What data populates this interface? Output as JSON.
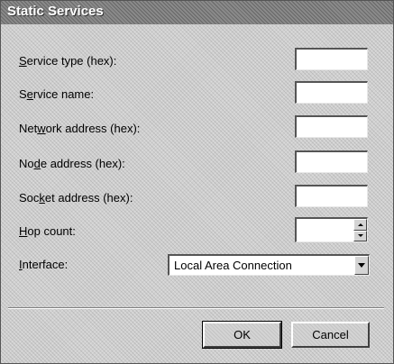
{
  "window": {
    "title": "Static Services"
  },
  "fields": [
    {
      "label_before": "",
      "accesskey": "S",
      "label_after": "ervice type (hex):",
      "value": ""
    },
    {
      "label_before": "S",
      "accesskey": "e",
      "label_after": "rvice name:",
      "value": ""
    },
    {
      "label_before": "Net",
      "accesskey": "w",
      "label_after": "ork address (hex):",
      "value": ""
    },
    {
      "label_before": "No",
      "accesskey": "d",
      "label_after": "e address (hex):",
      "value": ""
    },
    {
      "label_before": "Soc",
      "accesskey": "k",
      "label_after": "et address (hex):",
      "value": ""
    }
  ],
  "hop_count": {
    "label_before": "",
    "accesskey": "H",
    "label_after": "op count:",
    "value": ""
  },
  "interface": {
    "label_before": "",
    "accesskey": "I",
    "label_after": "nterface:",
    "selected": "Local Area Connection"
  },
  "buttons": {
    "ok": "OK",
    "cancel": "Cancel"
  },
  "icons": {
    "spin_up": "chevron-up-icon",
    "spin_down": "chevron-down-icon",
    "dropdown": "chevron-down-icon"
  }
}
